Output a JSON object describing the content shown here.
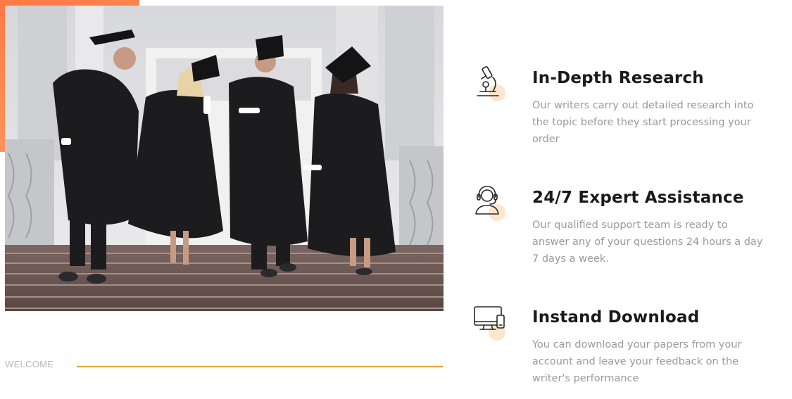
{
  "hero": {
    "image_alt": "graduates-walking-down-stairs-photo"
  },
  "welcome": {
    "label": "WELCOME",
    "line_color": "#e8a43a"
  },
  "colors": {
    "accent_corner": "#ff7a45",
    "icon_dot": "#fde6cc",
    "heading": "#1a1a1a",
    "body": "#9a9a9a"
  },
  "features": [
    {
      "icon": "microscope-icon",
      "title": "In-Depth Research",
      "text": "Our writers carry out detailed research into the topic before they start processing your order"
    },
    {
      "icon": "headset-icon",
      "title": "24/7 Expert Assistance",
      "text": "Our qualified support team is ready to answer any of your questions 24 hours a day 7 days a week."
    },
    {
      "icon": "devices-icon",
      "title": "Instand Download",
      "text": "You can download your papers from your account and leave your feedback on the writer's performance"
    }
  ]
}
